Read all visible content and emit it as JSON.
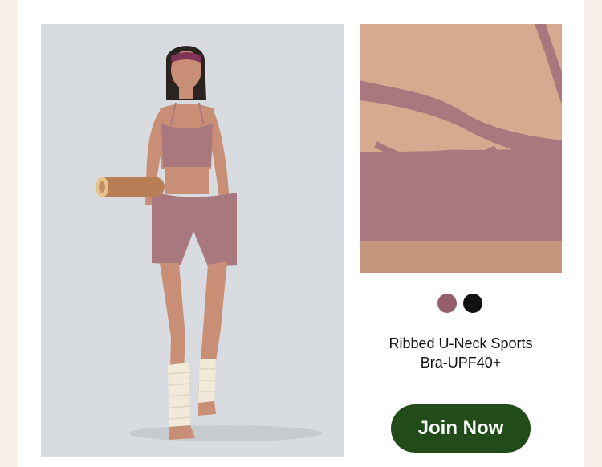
{
  "product": {
    "title": "Ribbed U-Neck Sports Bra-UPF40+",
    "hero_image": "model-wearing-ribbed-set",
    "detail_image": "back-strappy-detail"
  },
  "swatches": [
    {
      "name": "mauve",
      "color": "#955d6d"
    },
    {
      "name": "black",
      "color": "#111111"
    }
  ],
  "cta": {
    "label": "Join Now",
    "color": "#214c1a"
  },
  "colors": {
    "page_bg": "#f7efe9",
    "card_bg": "#ffffff",
    "image_bg": "#d8dce0",
    "fabric": "#a9787f"
  }
}
